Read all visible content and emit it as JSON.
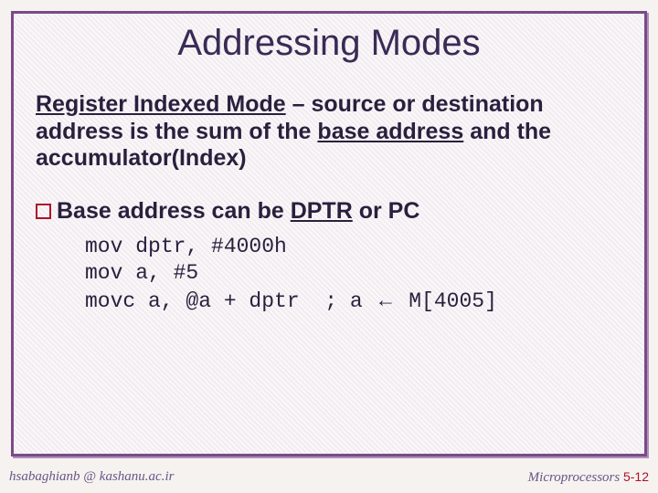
{
  "title": "Addressing Modes",
  "para": {
    "term": "Register Indexed Mode",
    "sep": " – ",
    "rest1": "source or destination address is the sum of the ",
    "under2": "base address",
    "rest2": " and the accumulator(Index)"
  },
  "bullet": {
    "pre": "Base address can be ",
    "under": "DPTR",
    "post": " or PC"
  },
  "code": {
    "l1": "mov dptr, #4000h",
    "l2": "mov a, #5",
    "l3a": "movc a, @a + dptr  ; a ",
    "arrow": "←",
    "l3b": " M[4005]"
  },
  "footer": {
    "left": "hsabaghianb @ kashanu.ac.ir",
    "right_label": "Microprocessors ",
    "right_num": "5-12"
  }
}
